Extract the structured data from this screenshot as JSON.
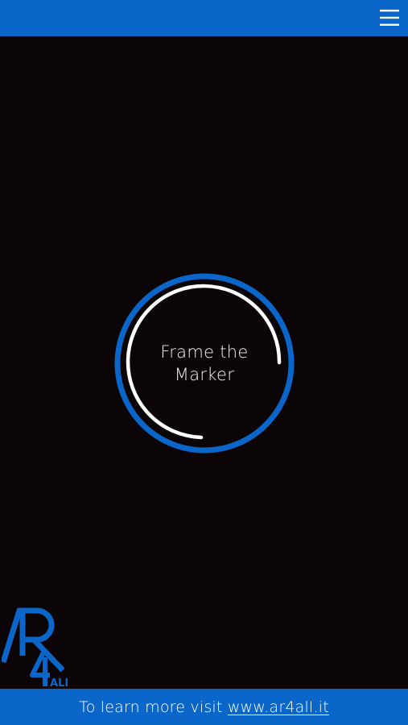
{
  "colors": {
    "brand_blue": "#0a66c8",
    "background": "#0c0508",
    "ring_white": "#ffffff"
  },
  "header": {
    "menu_icon": "hamburger-menu-icon"
  },
  "marker": {
    "line1": "Frame the",
    "line2": "Marker"
  },
  "logo": {
    "text": "AR4ALL"
  },
  "footer": {
    "prefix": "To learn more visit",
    "link": "www.ar4all.it"
  }
}
